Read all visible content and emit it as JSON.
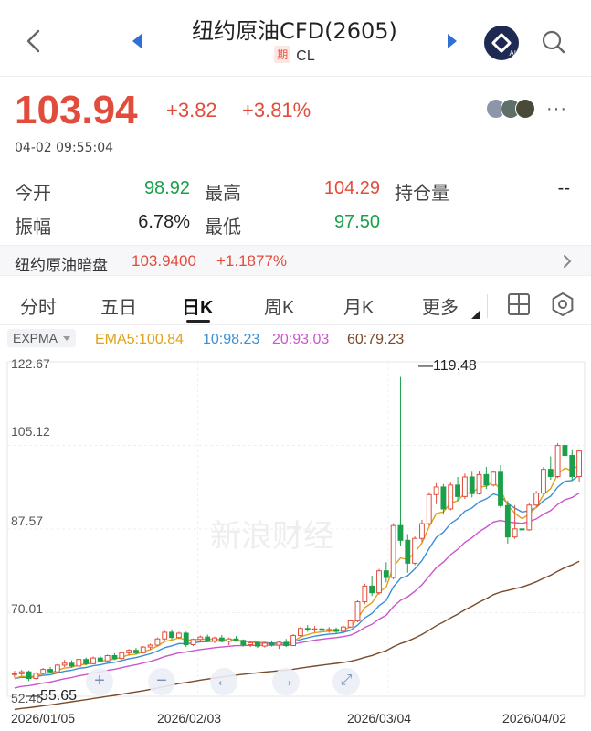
{
  "header": {
    "title": "纽约原油CFD(2605)",
    "period_tag": "期",
    "code": "CL",
    "ai_label": "AI"
  },
  "quote": {
    "price": "103.94",
    "change": "+3.82",
    "change_pct": "+3.81%",
    "time": "04-02 09:55:04"
  },
  "stats": [
    {
      "label": "今开",
      "value": "98.92",
      "color": "#1aa04a"
    },
    {
      "label": "最高",
      "value": "104.29",
      "color": "#e24c3c"
    },
    {
      "label": "持仓量",
      "value": "--",
      "color": "#222222"
    },
    {
      "label": "振幅",
      "value": "6.78%",
      "color": "#222222"
    },
    {
      "label": "最低",
      "value": "97.50",
      "color": "#1aa04a"
    }
  ],
  "dark_session": {
    "label": "纽约原油暗盘",
    "price": "103.9400",
    "change_pct": "+1.1877%"
  },
  "tabs": [
    "分时",
    "五日",
    "日K",
    "周K",
    "月K",
    "更多"
  ],
  "active_tab": "日K",
  "indicator": {
    "name": "EXPMA",
    "ema5": "EMA5:100.84",
    "ema10": "10:98.23",
    "ema20": "20:93.03",
    "ema60": "60:79.23"
  },
  "colors": {
    "up": "#e24c3c",
    "down": "#1aa04a",
    "ema5": "#e0a21b",
    "ema10": "#3a8fd6",
    "ema20": "#cc55cc",
    "ema60": "#7a4a2a"
  },
  "chart_data": {
    "type": "candlestick",
    "y_ticks": [
      "122.67",
      "105.12",
      "87.57",
      "70.01",
      "52.46"
    ],
    "ylim": [
      52.46,
      122.67
    ],
    "x_ticks": [
      "2026/01/05",
      "2026/02/03",
      "2026/03/04",
      "2026/04/02"
    ],
    "max_label": "119.48",
    "min_label": "55.65",
    "watermark": "新浪财经",
    "candles": [
      [
        57.1,
        57.8,
        56.4,
        57.2
      ],
      [
        57.2,
        58.0,
        56.8,
        57.6
      ],
      [
        57.6,
        57.9,
        55.65,
        56.2
      ],
      [
        56.2,
        57.5,
        56.0,
        57.3
      ],
      [
        57.3,
        58.4,
        57.0,
        58.1
      ],
      [
        58.1,
        58.6,
        57.3,
        57.6
      ],
      [
        57.6,
        59.2,
        57.4,
        59.0
      ],
      [
        59.0,
        60.1,
        58.6,
        59.4
      ],
      [
        59.4,
        60.0,
        58.5,
        58.8
      ],
      [
        58.8,
        60.4,
        58.7,
        60.2
      ],
      [
        60.2,
        60.6,
        59.0,
        59.3
      ],
      [
        59.3,
        60.8,
        59.2,
        60.5
      ],
      [
        60.5,
        61.0,
        59.6,
        59.9
      ],
      [
        59.9,
        61.2,
        59.7,
        61.0
      ],
      [
        61.0,
        61.5,
        60.1,
        60.4
      ],
      [
        60.4,
        61.8,
        60.2,
        61.6
      ],
      [
        61.6,
        62.4,
        61.0,
        62.1
      ],
      [
        62.1,
        62.6,
        61.3,
        61.6
      ],
      [
        61.6,
        63.0,
        61.5,
        62.8
      ],
      [
        62.8,
        63.5,
        62.2,
        63.2
      ],
      [
        63.2,
        64.8,
        63.0,
        64.5
      ],
      [
        64.5,
        66.2,
        64.2,
        65.9
      ],
      [
        65.9,
        66.5,
        64.4,
        64.8
      ],
      [
        64.8,
        66.0,
        64.5,
        65.7
      ],
      [
        65.7,
        66.0,
        62.8,
        63.3
      ],
      [
        63.3,
        64.6,
        63.0,
        64.4
      ],
      [
        64.4,
        65.2,
        63.8,
        64.9
      ],
      [
        64.9,
        65.4,
        63.9,
        64.1
      ],
      [
        64.1,
        65.0,
        63.6,
        64.7
      ],
      [
        64.7,
        65.3,
        63.8,
        64.0
      ],
      [
        64.0,
        64.8,
        63.2,
        64.5
      ],
      [
        64.5,
        65.1,
        63.9,
        64.2
      ],
      [
        64.2,
        64.4,
        62.9,
        63.3
      ],
      [
        63.3,
        64.0,
        62.8,
        63.7
      ],
      [
        63.7,
        64.1,
        62.6,
        63.0
      ],
      [
        63.0,
        63.9,
        62.7,
        63.6
      ],
      [
        63.6,
        64.2,
        62.9,
        63.2
      ],
      [
        63.2,
        64.0,
        62.4,
        63.8
      ],
      [
        63.8,
        64.5,
        62.8,
        63.1
      ],
      [
        63.1,
        65.5,
        63.0,
        65.2
      ],
      [
        65.2,
        67.0,
        65.0,
        66.7
      ],
      [
        66.7,
        67.4,
        66.0,
        66.4
      ],
      [
        66.4,
        67.2,
        65.9,
        66.6
      ],
      [
        66.6,
        67.1,
        66.0,
        66.3
      ],
      [
        66.3,
        67.0,
        65.8,
        66.5
      ],
      [
        66.5,
        66.9,
        65.7,
        66.1
      ],
      [
        66.1,
        67.3,
        66.0,
        67.0
      ],
      [
        67.0,
        68.6,
        66.8,
        68.3
      ],
      [
        68.3,
        72.6,
        68.0,
        72.3
      ],
      [
        72.3,
        76.1,
        71.8,
        75.6
      ],
      [
        75.6,
        77.8,
        73.5,
        74.2
      ],
      [
        74.2,
        79.2,
        73.8,
        78.8
      ],
      [
        78.8,
        80.6,
        76.4,
        77.4
      ],
      [
        77.4,
        88.8,
        77.0,
        88.3
      ],
      [
        88.3,
        119.48,
        84.0,
        85.2
      ],
      [
        85.2,
        86.5,
        78.4,
        80.4
      ],
      [
        80.4,
        86.0,
        80.0,
        85.6
      ],
      [
        85.6,
        89.5,
        84.8,
        88.7
      ],
      [
        88.7,
        95.3,
        88.3,
        94.8
      ],
      [
        94.8,
        97.2,
        92.8,
        96.4
      ],
      [
        96.4,
        97.0,
        90.6,
        91.8
      ],
      [
        91.8,
        97.5,
        91.5,
        96.8
      ],
      [
        96.8,
        98.5,
        93.5,
        94.4
      ],
      [
        94.4,
        99.2,
        93.9,
        98.5
      ],
      [
        98.5,
        99.6,
        94.2,
        95.0
      ],
      [
        95.0,
        99.7,
        94.8,
        99.0
      ],
      [
        99.0,
        100.6,
        96.0,
        96.8
      ],
      [
        96.8,
        99.7,
        96.5,
        99.5
      ],
      [
        99.5,
        101.0,
        92.0,
        92.5
      ],
      [
        92.5,
        93.5,
        84.5,
        85.9
      ],
      [
        85.9,
        92.6,
        85.5,
        87.6
      ],
      [
        87.6,
        89.0,
        86.5,
        87.4
      ],
      [
        87.4,
        93.0,
        87.2,
        92.6
      ],
      [
        92.6,
        95.6,
        92.3,
        95.1
      ],
      [
        95.1,
        100.6,
        94.8,
        100.1
      ],
      [
        100.1,
        102.8,
        97.9,
        98.6
      ],
      [
        98.6,
        105.6,
        98.3,
        105.1
      ],
      [
        105.1,
        107.3,
        102.5,
        103.0
      ],
      [
        103.0,
        104.3,
        97.8,
        98.6
      ],
      [
        98.6,
        104.3,
        97.5,
        103.94
      ]
    ]
  }
}
